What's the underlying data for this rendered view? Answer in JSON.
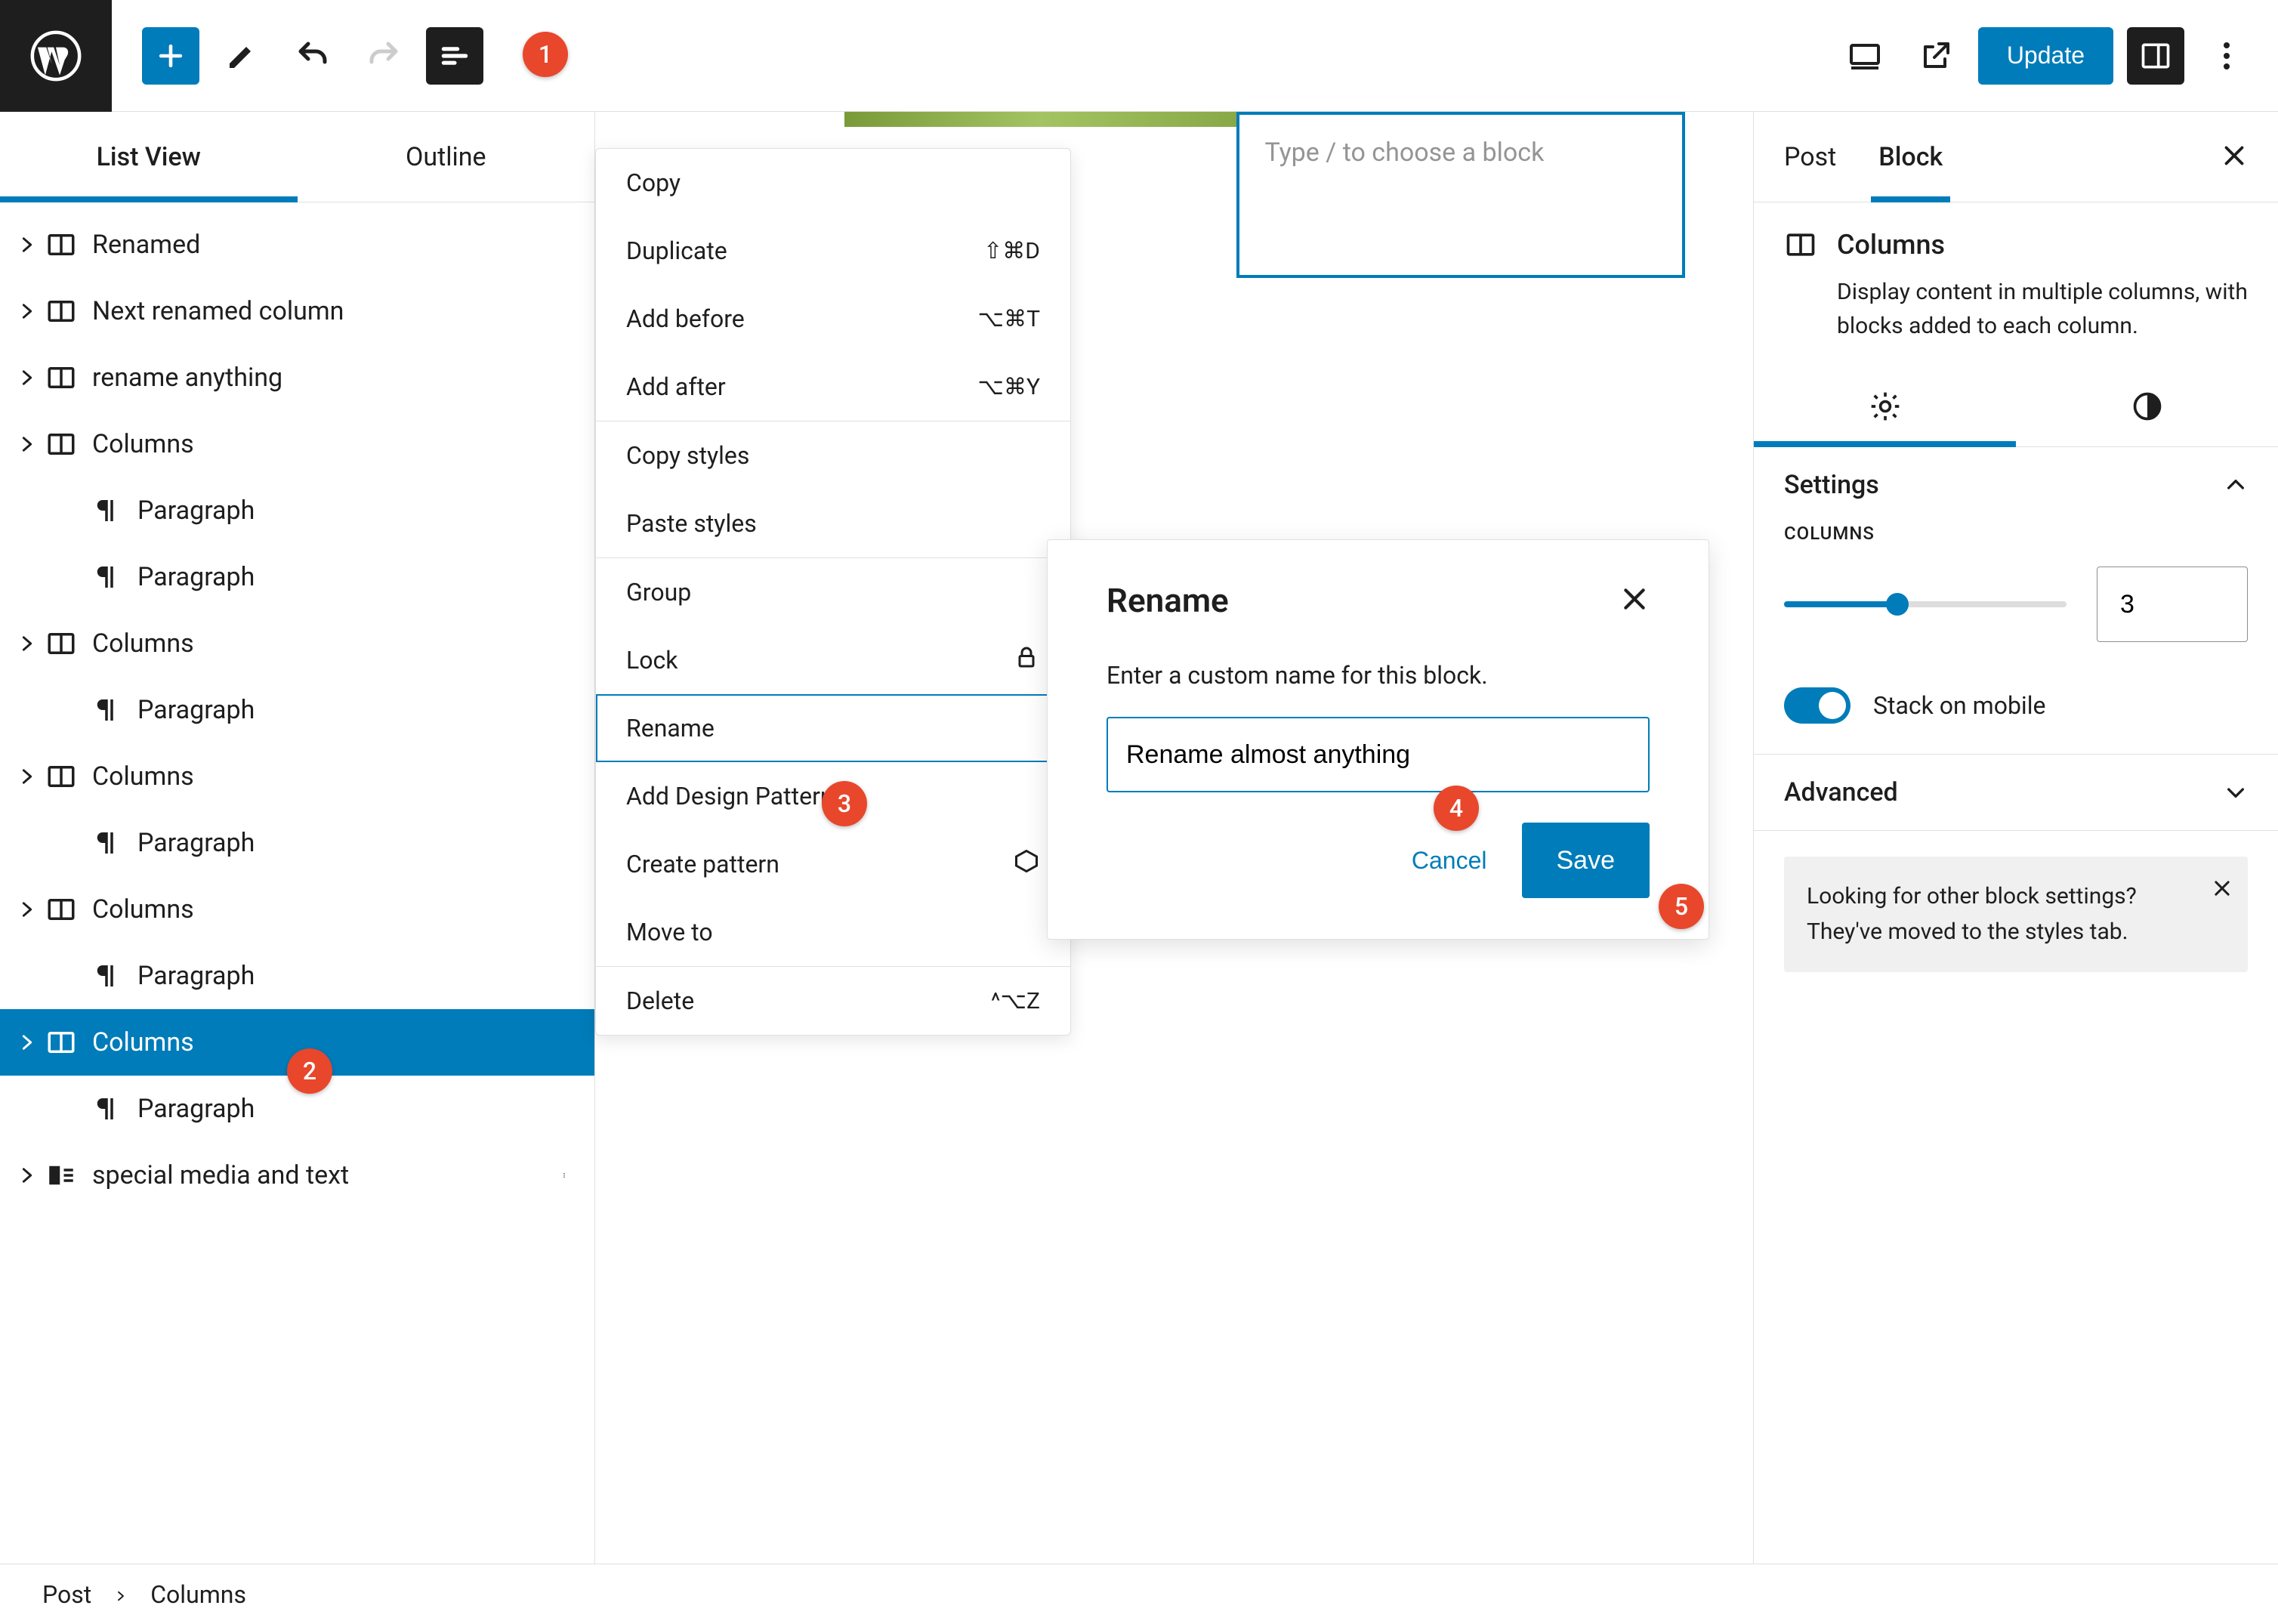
{
  "topbar": {
    "update_label": "Update"
  },
  "left": {
    "tabs": {
      "listview": "List View",
      "outline": "Outline"
    },
    "tree": [
      {
        "label": "Renamed",
        "type": "columns",
        "caret": true
      },
      {
        "label": "Next renamed column",
        "type": "columns",
        "caret": true
      },
      {
        "label": "rename anything",
        "type": "columns",
        "caret": true
      },
      {
        "label": "Columns",
        "type": "columns",
        "caret": true
      },
      {
        "label": "Paragraph",
        "type": "paragraph",
        "indent": true
      },
      {
        "label": "Paragraph",
        "type": "paragraph",
        "indent": true
      },
      {
        "label": "Columns",
        "type": "columns",
        "caret": true
      },
      {
        "label": "Paragraph",
        "type": "paragraph",
        "indent": true
      },
      {
        "label": "Columns",
        "type": "columns",
        "caret": true
      },
      {
        "label": "Paragraph",
        "type": "paragraph",
        "indent": true
      },
      {
        "label": "Columns",
        "type": "columns",
        "caret": true
      },
      {
        "label": "Paragraph",
        "type": "paragraph",
        "indent": true
      },
      {
        "label": "Columns",
        "type": "columns",
        "caret": true,
        "selected": true
      },
      {
        "label": "Paragraph",
        "type": "paragraph",
        "indent": true
      },
      {
        "label": "special media and text",
        "type": "media",
        "caret": true,
        "more": true
      }
    ]
  },
  "canvas": {
    "placeholder": "Type / to choose a block"
  },
  "ctx": {
    "copy": "Copy",
    "duplicate": {
      "label": "Duplicate",
      "kbd": "⇧⌘D"
    },
    "add_before": {
      "label": "Add before",
      "kbd": "⌥⌘T"
    },
    "add_after": {
      "label": "Add after",
      "kbd": "⌥⌘Y"
    },
    "copy_styles": "Copy styles",
    "paste_styles": "Paste styles",
    "group": "Group",
    "lock": "Lock",
    "rename": "Rename",
    "add_design": "Add Design Pattern",
    "create_pattern": "Create pattern",
    "move_to": "Move to",
    "delete": {
      "label": "Delete",
      "kbd": "^⌥Z"
    }
  },
  "modal": {
    "title": "Rename",
    "desc": "Enter a custom name for this block.",
    "value": "Rename almost anything",
    "cancel": "Cancel",
    "save": "Save"
  },
  "right": {
    "tabs": {
      "post": "Post",
      "block": "Block"
    },
    "block_title": "Columns",
    "block_desc": "Display content in multiple columns, with blocks added to each column.",
    "settings": {
      "label": "Settings",
      "columns_label": "COLUMNS",
      "columns_value": "3",
      "stack_label": "Stack on mobile"
    },
    "advanced": "Advanced",
    "hint": "Looking for other block settings? They've moved to the styles tab."
  },
  "footer": {
    "crumb1": "Post",
    "crumb2": "Columns"
  },
  "markers": {
    "m1": "1",
    "m2": "2",
    "m3": "3",
    "m4": "4",
    "m5": "5"
  }
}
